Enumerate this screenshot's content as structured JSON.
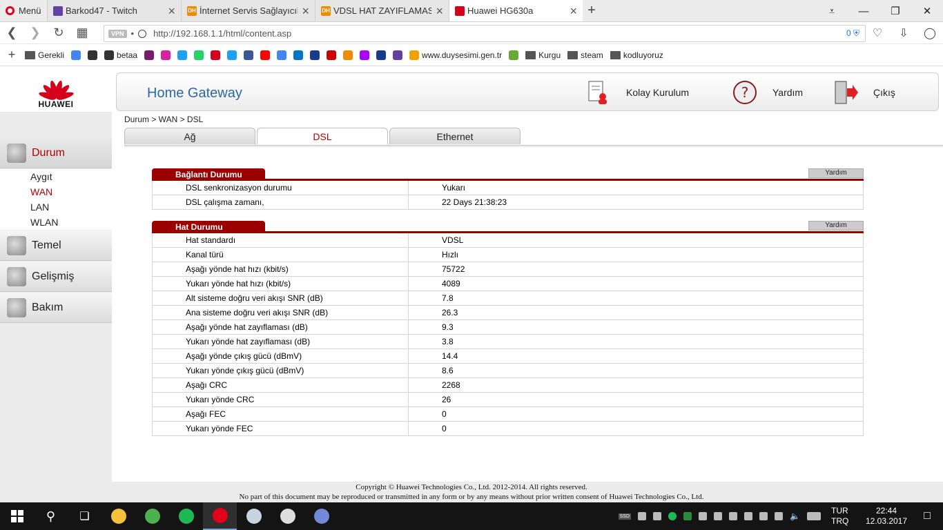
{
  "browser": {
    "menu_label": "Menü",
    "tabs": [
      {
        "title": "Barkod47 - Twitch",
        "favicon": "twitch-icon",
        "color": "#6441a5"
      },
      {
        "title": "İnternet Servis Sağlayıcılar",
        "favicon": "dh-icon",
        "color": "#f08a00"
      },
      {
        "title": "VDSL HAT ZAYIFLAMASI (d",
        "favicon": "dh-icon",
        "color": "#f08a00"
      },
      {
        "title": "Huawei HG630a",
        "favicon": "huawei-icon",
        "color": "#d5001c",
        "active": true
      }
    ],
    "favicon_text_dh": "DH",
    "url": "http://192.168.1.1/html/content.asp",
    "vpn_label": "VPN",
    "adblock_count": "0",
    "bookmarks": [
      {
        "label": "Gerekli",
        "type": "folder"
      },
      {
        "label": "",
        "type": "icon",
        "color": "#4285f4"
      },
      {
        "label": "",
        "type": "icon",
        "color": "#333"
      },
      {
        "label": "betaa",
        "type": "icon",
        "color": "#333"
      },
      {
        "label": "",
        "type": "icon",
        "color": "#7a1c6d"
      },
      {
        "label": "",
        "type": "icon",
        "color": "#d6249f"
      },
      {
        "label": "",
        "type": "icon",
        "color": "#1da1f2"
      },
      {
        "label": "",
        "type": "icon",
        "color": "#25d366"
      },
      {
        "label": "",
        "type": "icon",
        "color": "#d5001c"
      },
      {
        "label": "",
        "type": "icon",
        "color": "#1da1f2"
      },
      {
        "label": "",
        "type": "icon",
        "color": "#3b5998"
      },
      {
        "label": "",
        "type": "icon",
        "color": "#ff0000"
      },
      {
        "label": "",
        "type": "icon",
        "color": "#4285f4"
      },
      {
        "label": "",
        "type": "icon",
        "color": "#0077c8"
      },
      {
        "label": "",
        "type": "icon",
        "color": "#1a3a8a"
      },
      {
        "label": "",
        "type": "icon",
        "color": "#c00"
      },
      {
        "label": "",
        "type": "icon",
        "color": "#f08a00"
      },
      {
        "label": "",
        "type": "icon",
        "color": "#a0f"
      },
      {
        "label": "",
        "type": "icon",
        "color": "#1a3a8a"
      },
      {
        "label": "",
        "type": "icon",
        "color": "#6441a5"
      },
      {
        "label": "www.duysesimi.gen.tr",
        "type": "icon",
        "color": "#f0a000"
      },
      {
        "label": "",
        "type": "icon",
        "color": "#6a3"
      },
      {
        "label": "Kurgu",
        "type": "folder"
      },
      {
        "label": "steam",
        "type": "folder"
      },
      {
        "label": "kodluyoruz",
        "type": "folder"
      }
    ]
  },
  "router": {
    "logo_text": "HUAWEI",
    "title": "Home Gateway",
    "header_links": {
      "setup": "Kolay Kurulum",
      "help": "Yardım",
      "logout": "Çıkış"
    },
    "breadcrumb": "Durum > WAN > DSL",
    "subtabs": [
      "Ağ",
      "DSL",
      "Ethernet"
    ],
    "active_subtab": "DSL",
    "sidebar": {
      "sections": [
        {
          "label": "Durum",
          "active": true
        },
        {
          "label": "Temel"
        },
        {
          "label": "Gelişmiş"
        },
        {
          "label": "Bakım"
        }
      ],
      "durum_items": [
        {
          "label": "Aygıt"
        },
        {
          "label": "WAN",
          "active": true
        },
        {
          "label": "LAN"
        },
        {
          "label": "WLAN"
        }
      ]
    },
    "connection_panel": {
      "title": "Bağlantı Durumu",
      "help": "Yardım",
      "rows": [
        {
          "key": "DSL senkronizasyon durumu",
          "value": "Yukarı"
        },
        {
          "key": "DSL çalışma zamanı,",
          "value": "22 Days 21:38:23"
        }
      ]
    },
    "line_panel": {
      "title": "Hat Durumu",
      "help": "Yardım",
      "rows": [
        {
          "key": "Hat standardı",
          "value": "VDSL"
        },
        {
          "key": "Kanal türü",
          "value": "Hızlı"
        },
        {
          "key": "Aşağı yönde hat hızı (kbit/s)",
          "value": "75722"
        },
        {
          "key": "Yukarı yönde hat hızı (kbit/s)",
          "value": "4089"
        },
        {
          "key": "Alt sisteme doğru veri akışı SNR (dB)",
          "value": "7.8"
        },
        {
          "key": "Ana sisteme doğru veri akışı SNR (dB)",
          "value": "26.3"
        },
        {
          "key": "Aşağı yönde hat zayıflaması (dB)",
          "value": "9.3"
        },
        {
          "key": "Yukarı yönde hat zayıflaması (dB)",
          "value": "3.8"
        },
        {
          "key": "Aşağı yönde çıkış gücü (dBmV)",
          "value": "14.4"
        },
        {
          "key": "Yukarı yönde çıkış gücü (dBmV)",
          "value": "8.6"
        },
        {
          "key": "Aşağı CRC",
          "value": "2268"
        },
        {
          "key": "Yukarı yönde CRC",
          "value": "26"
        },
        {
          "key": "Aşağı FEC",
          "value": "0"
        },
        {
          "key": "Yukarı yönde FEC",
          "value": "0"
        }
      ]
    },
    "footer": {
      "line1": "Copyright © Huawei Technologies Co., Ltd. 2012-2014. All rights reserved.",
      "line2": "No part of this document may be reproduced or transmitted in any form or by any means without prior written consent of Huawei Technologies Co., Ltd."
    }
  },
  "taskbar": {
    "apps": [
      {
        "name": "file-explorer-icon",
        "color": "#f3c13a"
      },
      {
        "name": "chrome-icon",
        "color": "#4caf50"
      },
      {
        "name": "spotify-icon",
        "color": "#1db954"
      },
      {
        "name": "opera-icon",
        "color": "#e2001a",
        "active": true
      },
      {
        "name": "steam-icon",
        "color": "#c7d5e0"
      },
      {
        "name": "unity-icon",
        "color": "#ddd"
      },
      {
        "name": "discord-icon",
        "color": "#7289da"
      }
    ],
    "tray_badge": "SSD",
    "lang_top": "TUR",
    "lang_bottom": "TRQ",
    "time": "22:44",
    "date": "12.03.2017"
  }
}
